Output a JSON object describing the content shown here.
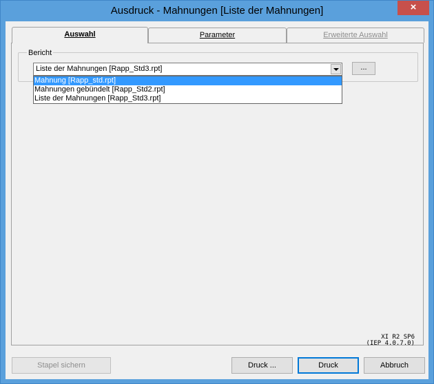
{
  "window": {
    "title": "Ausdruck - Mahnungen [Liste der Mahnungen]",
    "close_glyph": "×"
  },
  "tabs": [
    {
      "label": "Auswahl",
      "state": "active"
    },
    {
      "label": "Parameter",
      "state": "normal"
    },
    {
      "label": "Erweiterte Auswahl",
      "state": "disabled"
    }
  ],
  "bericht": {
    "group_label": "Bericht",
    "selected_value": "Liste der Mahnungen [Rapp_Std3.rpt]",
    "browse_label": "...",
    "options": [
      "Mahnung [Rapp_std.rpt]",
      "Mahnungen gebündelt [Rapp_Std2.rpt]",
      "Liste der Mahnungen [Rapp_Std3.rpt]"
    ],
    "highlighted_index": 0
  },
  "version": {
    "line1": "XI R2 SP6",
    "line2": "(IEP 4.0.7.0)"
  },
  "buttons": {
    "stapel_sichern": "Stapel sichern",
    "druck_dialog": "Druck ...",
    "druck": "Druck",
    "abbruch": "Abbruch"
  },
  "colors": {
    "titlebar": "#5aa0dc",
    "close": "#c7504b",
    "highlight": "#3399ff",
    "default_button_border": "#0078d7"
  }
}
